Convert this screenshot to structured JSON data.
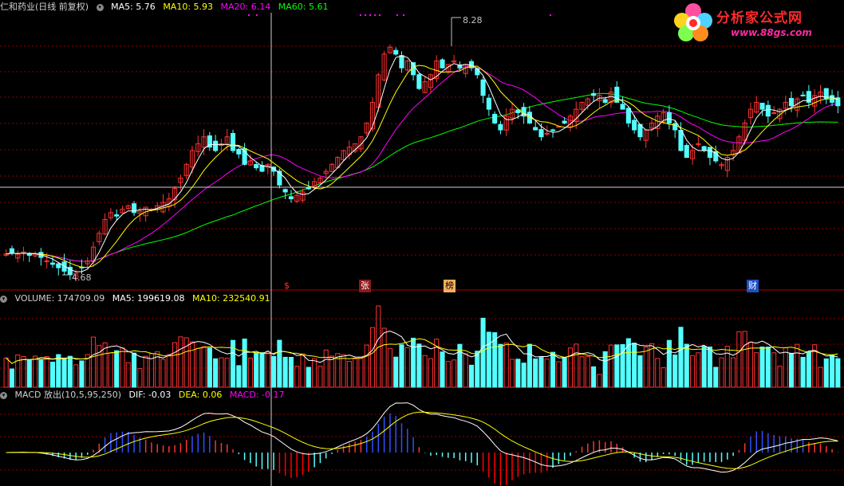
{
  "main": {
    "title": "仁和药业(日线 前复权)",
    "ma5_label": "MA5: 5.76",
    "ma10_label": "MA10: 5.93",
    "ma20_label": "MA20: 6.14",
    "ma60_label": "MA60: 5.61",
    "high_marker": "8.28",
    "low_marker": "4.68",
    "event_tags": [
      "$",
      "张",
      "榜",
      "财"
    ]
  },
  "volume": {
    "title": "VOLUME: 174709.09",
    "ma5_label": "MA5: 199619.08",
    "ma10_label": "MA10: 232540.91"
  },
  "macd": {
    "title": "MACD 放出(10,5,95,250)",
    "dif_label": "DIF: -0.03",
    "dea_label": "DEA: 0.06",
    "macd_label": "MACD: -0.17"
  },
  "logo": {
    "title": "分析家公式网",
    "url": "www.88gs.com"
  },
  "colors": {
    "up": "#ff3232",
    "down": "#54ffff",
    "ma5": "#ffffff",
    "ma10": "#ffff00",
    "ma20": "#ff00ff",
    "ma60": "#00ff00",
    "grid": "#8b0000",
    "macd_neg": "#54ffff",
    "macd_pos": "#ff3232",
    "macd_strong_pos": "#3050ff",
    "macd_strong_neg": "#ff0000"
  },
  "chart_data": [
    {
      "type": "candlestick",
      "title": "仁和药业(日线 前复权)",
      "ylim": [
        4.5,
        8.5
      ],
      "series": [
        {
          "name": "MA5",
          "last": 5.76
        },
        {
          "name": "MA10",
          "last": 5.93
        },
        {
          "name": "MA20",
          "last": 6.14
        },
        {
          "name": "MA60",
          "last": 5.61
        }
      ],
      "close": [
        5.0,
        5.02,
        5.0,
        5.03,
        4.98,
        5.0,
        4.95,
        4.9,
        4.85,
        4.8,
        4.75,
        4.7,
        4.72,
        4.8,
        4.9,
        5.1,
        5.3,
        5.5,
        5.6,
        5.55,
        5.65,
        5.7,
        5.6,
        5.62,
        5.68,
        5.65,
        5.7,
        5.75,
        5.8,
        5.95,
        6.1,
        6.3,
        6.5,
        6.6,
        6.7,
        6.55,
        6.5,
        6.6,
        6.7,
        6.5,
        6.45,
        6.3,
        6.35,
        6.25,
        6.2,
        6.3,
        6.2,
        6.0,
        5.9,
        5.8,
        5.85,
        5.9,
        5.95,
        6.05,
        6.1,
        6.2,
        6.3,
        6.4,
        6.5,
        6.55,
        6.6,
        6.7,
        6.9,
        7.2,
        7.6,
        7.9,
        8.0,
        7.9,
        7.7,
        7.8,
        7.6,
        7.4,
        7.5,
        7.6,
        7.8,
        7.7,
        7.75,
        7.8,
        7.7,
        7.75,
        7.7,
        7.6,
        7.3,
        7.1,
        6.9,
        6.8,
        7.0,
        7.1,
        7.05,
        7.0,
        6.9,
        6.8,
        6.7,
        6.75,
        6.8,
        6.85,
        6.9,
        7.0,
        7.1,
        7.2,
        7.25,
        7.3,
        7.3,
        7.2,
        7.35,
        7.2,
        7.1,
        6.9,
        6.8,
        6.7,
        6.8,
        6.9,
        7.0,
        7.05,
        6.9,
        6.8,
        6.5,
        6.4,
        6.5,
        6.6,
        6.5,
        6.4,
        6.35,
        6.3,
        6.4,
        6.5,
        6.7,
        6.9,
        7.1,
        7.2,
        7.1,
        7.0,
        7.05,
        7.1,
        7.2,
        7.15,
        7.25,
        7.3,
        7.2,
        7.3,
        7.35,
        7.25,
        7.2,
        7.15
      ],
      "x_markers": {
        "high": 8.28,
        "low": 4.68
      }
    },
    {
      "type": "bar",
      "title": "VOLUME",
      "series": [
        {
          "name": "VOLUME",
          "last": 174709.09
        },
        {
          "name": "MA5",
          "last": 199619.08
        },
        {
          "name": "MA10",
          "last": 232540.91
        }
      ],
      "ylim": [
        0,
        450000
      ]
    },
    {
      "type": "bar",
      "title": "MACD 放出(10,5,95,250)",
      "series": [
        {
          "name": "DIF",
          "last": -0.03
        },
        {
          "name": "DEA",
          "last": 0.06
        },
        {
          "name": "MACD",
          "last": -0.17
        }
      ],
      "ylim": [
        -0.5,
        0.8
      ]
    }
  ]
}
